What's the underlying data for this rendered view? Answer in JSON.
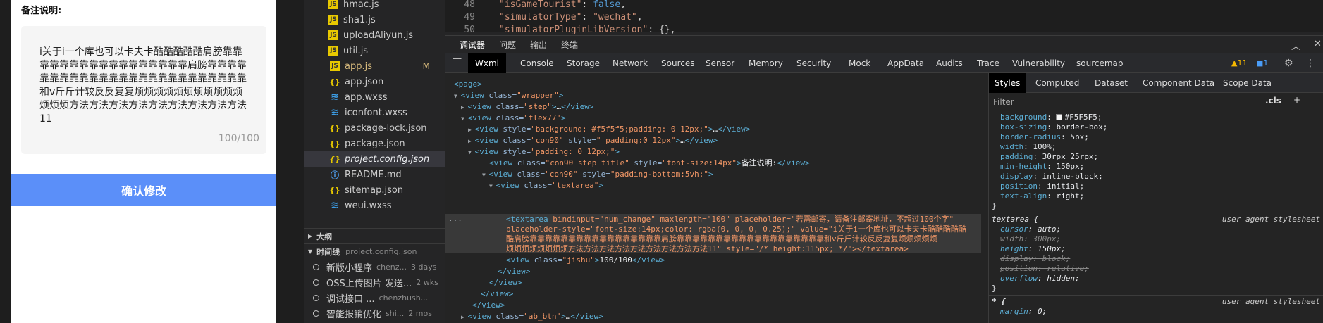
{
  "preview": {
    "note_title": "备注说明:",
    "textarea_value": "i关于i一个库也可以卡夫卡酷酷酷酷酷肩膀靠靠靠靠靠靠靠靠靠靠靠靠靠靠靠靠靠肩膀靠靠靠靠靠靠靠靠靠靠靠靠靠靠靠靠靠靠靠靠靠靠靠靠靠和v斤斤计较反反复复烦烦烦烦烦烦烦烦烦烦烦烦烦烦方法方法方法方法方法方法方法方法方法11",
    "counter": "100/100",
    "confirm_button": "确认修改"
  },
  "explorer": {
    "files": [
      {
        "name": "hmac.js",
        "type": "js"
      },
      {
        "name": "sha1.js",
        "type": "js"
      },
      {
        "name": "uploadAliyun.js",
        "type": "js"
      },
      {
        "name": "util.js",
        "type": "js"
      },
      {
        "name": "app.js",
        "type": "js",
        "badge": "M"
      },
      {
        "name": "app.json",
        "type": "json"
      },
      {
        "name": "app.wxss",
        "type": "wxss"
      },
      {
        "name": "iconfont.wxss",
        "type": "wxss"
      },
      {
        "name": "package-lock.json",
        "type": "json"
      },
      {
        "name": "package.json",
        "type": "json"
      },
      {
        "name": "project.config.json",
        "type": "json"
      },
      {
        "name": "README.md",
        "type": "md"
      },
      {
        "name": "sitemap.json",
        "type": "json"
      },
      {
        "name": "weui.wxss",
        "type": "wxss"
      }
    ],
    "outline_label": "大纲",
    "timeline_label": "时间线",
    "timeline_file": "project.config.json",
    "timeline": [
      {
        "msg": "新版小程序",
        "author": "chenz...",
        "time": "3 days"
      },
      {
        "msg": "OSS上传图片 发送...",
        "author": "",
        "time": "2 wks"
      },
      {
        "msg": "调试接口 ...",
        "author": "chenzhush...",
        "time": ""
      },
      {
        "msg": "智能报销优化",
        "author": "shi...",
        "time": "2 mos"
      }
    ]
  },
  "editor": {
    "lines": [
      {
        "num": "48",
        "key": "\"isGameTourist\"",
        "val": "false",
        "val_type": "bool"
      },
      {
        "num": "49",
        "key": "\"simulatorType\"",
        "val": "\"wechat\"",
        "val_type": "str"
      },
      {
        "num": "50",
        "key": "\"simulatorPluginLibVersion\"",
        "val": "{},",
        "val_type": "obj"
      }
    ]
  },
  "panel": {
    "tabs": [
      "调试器",
      "问题",
      "输出",
      "终端"
    ]
  },
  "devtools": {
    "tabs": [
      "Wxml",
      "Console",
      "Storage",
      "Network",
      "Sources",
      "Sensor",
      "Memory",
      "Security",
      "Mock",
      "AppData",
      "Audits",
      "Trace",
      "Vulnerability",
      "sourcemap"
    ],
    "warnings": "▲11",
    "messages": "■1",
    "tree": {
      "page": "<page>",
      "view": "view",
      "class": "class",
      "style": "style",
      "wrapper": "\"wrapper\"",
      "step": "\"step\"",
      "flex77": "\"flex77\"",
      "style_bg": "\"background: #f5f5f5;padding: 0 12px;\"",
      "con90": "\"con90\"",
      "style_pad": "\" padding:0 12px\"",
      "style_pad2": "\"padding: 0 12px;\"",
      "con90_title": "\"con90 step_title\"",
      "font14": "\"font-size:14px\"",
      "note_text": "备注说明:",
      "pad_bottom": "\"padding-bottom:5vh;\"",
      "textarea_cls": "\"textarea\"",
      "textarea_tag": "textarea",
      "ta_line1": "bindinput=\"num_change\" maxlength=\"100\" placeholder=\"若需邮寄，请备注邮寄地址，不超过100个字\"",
      "ta_line2": "placeholder-style=\"font-size:14px;color: rgba(0, 0, 0, 0.25);\" value=\"i关于i一个库也可以卡夫卡酷酷酷酷酷",
      "ta_line3": "酷肩膀靠靠靠靠靠靠靠靠靠靠靠靠靠靠靠靠靠肩膀靠靠靠靠靠靠靠靠靠靠靠靠靠靠靠靠靠靠靠和v斤斤计较反反复复烦烦烦烦烦",
      "ta_line4": "烦烦烦烦烦烦烦烦方法方法方法方法方法方法方法方法方法11\" style=\"/* height:115px; */\"></textarea>",
      "jishu": "\"jishu\"",
      "jishu_text": "100/100",
      "ab_btn": "\"ab_btn\""
    }
  },
  "styles": {
    "tabs": [
      "Styles",
      "Computed",
      "Dataset",
      "Component Data",
      "Scope Data"
    ],
    "filter_placeholder": "Filter",
    "cls": ".cls",
    "plus": "+",
    "rules1": [
      {
        "prop": "background",
        "val": "#F5F5F5;"
      },
      {
        "prop": "box-sizing",
        "val": "border-box;"
      },
      {
        "prop": "border-radius",
        "val": "5px;"
      },
      {
        "prop": "width",
        "val": "100%;"
      },
      {
        "prop": "padding",
        "val": "30rpx 25rpx;"
      },
      {
        "prop": "min-height",
        "val": "150px;"
      },
      {
        "prop": "display",
        "val": "inline-block;"
      },
      {
        "prop": "position",
        "val": "initial;"
      },
      {
        "prop": "text-align",
        "val": "right;"
      }
    ],
    "textarea_selector": "textarea {",
    "user_agent": "user agent stylesheet",
    "rules2": [
      {
        "prop": "cursor",
        "val": "auto;",
        "strike": false
      },
      {
        "prop": "width",
        "val": "300px;",
        "strike": true
      },
      {
        "prop": "height",
        "val": "150px;",
        "strike": false
      },
      {
        "prop": "display",
        "val": "block;",
        "strike": true
      },
      {
        "prop": "position",
        "val": "relative;",
        "strike": true
      },
      {
        "prop": "overflow",
        "val": "hidden;",
        "strike": false
      }
    ],
    "star_selector": "* {",
    "rules3": [
      {
        "prop": "margin",
        "val": "0;"
      }
    ]
  }
}
